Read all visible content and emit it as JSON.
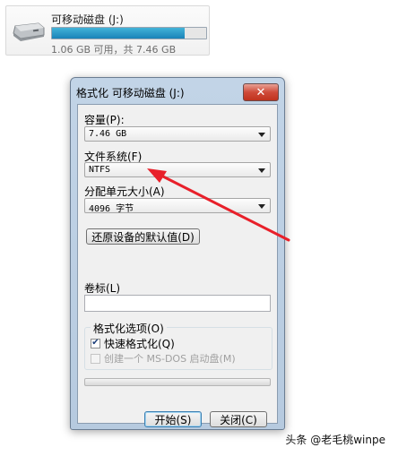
{
  "drive": {
    "name": "可移动磁盘 (J:)",
    "free_text": "1.06 GB 可用，共 7.46 GB",
    "usage_fraction": 0.86,
    "icon": "removable-drive-icon"
  },
  "dialog": {
    "title": "格式化 可移动磁盘 (J:)",
    "close_label": "✕",
    "capacity": {
      "label": "容量(P):",
      "value": "7.46 GB"
    },
    "filesystem": {
      "label": "文件系统(F)",
      "value": "NTFS"
    },
    "allocation": {
      "label": "分配单元大小(A)",
      "value": "4096 字节"
    },
    "restore_button": "还原设备的默认值(D)",
    "volume": {
      "label": "卷标(L)",
      "value": ""
    },
    "options": {
      "title": "格式化选项(O)",
      "quick": {
        "label": "快速格式化(Q)",
        "checked": true
      },
      "msdos": {
        "label": "创建一个 MS-DOS 启动盘(M)",
        "checked": false,
        "enabled": false
      }
    },
    "progress_fraction": 0,
    "start_button": "开始(S)",
    "close_button": "关闭(C)"
  },
  "annotation": {
    "arrow_color": "#e8202a"
  },
  "watermark": {
    "text": "头条 @老毛桃winpe"
  }
}
